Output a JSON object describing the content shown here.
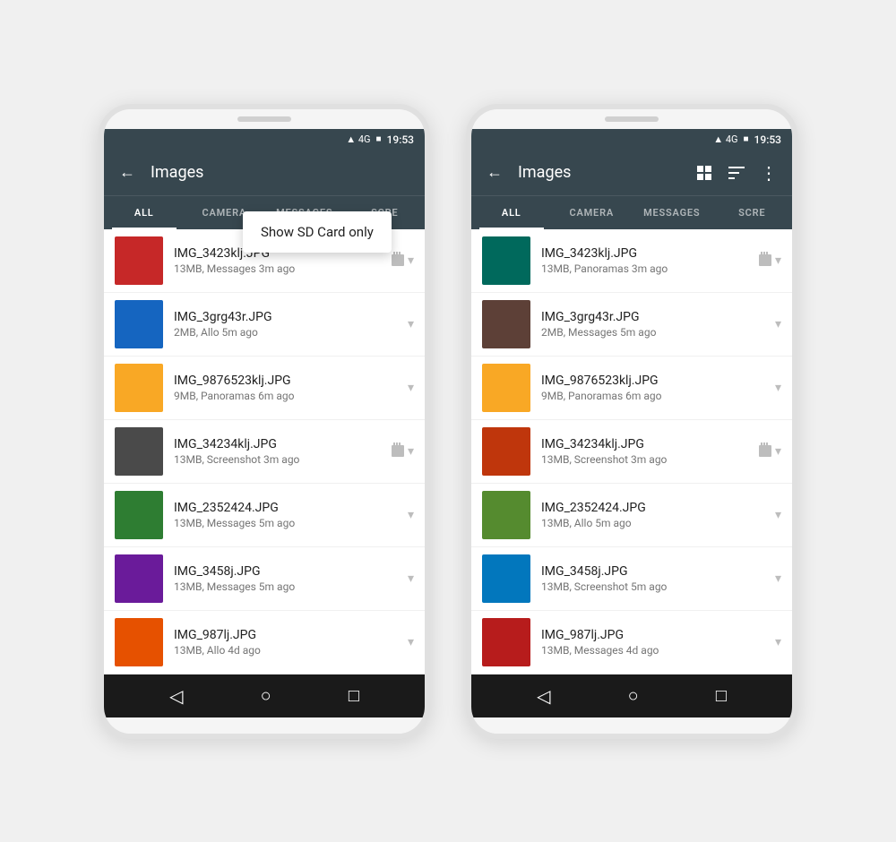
{
  "phones": [
    {
      "id": "phone-left",
      "statusBar": {
        "signal": "▲ 4G",
        "battery": "🔋",
        "time": "19:53"
      },
      "appBar": {
        "backIcon": "←",
        "title": "Images",
        "showDropdown": true
      },
      "dropdown": {
        "label": "Show SD Card only"
      },
      "tabs": [
        {
          "label": "ALL",
          "active": true
        },
        {
          "label": "CAMERA",
          "active": false
        },
        {
          "label": "MESSAGES",
          "active": false
        },
        {
          "label": "SCRE",
          "active": false
        }
      ],
      "files": [
        {
          "name": "IMG_3423klj.JPG",
          "meta": "13MB, Messages  3m ago",
          "thumbClass": "thumb-red"
        },
        {
          "name": "IMG_3grg43r.JPG",
          "meta": "2MB, Allo  5m ago",
          "thumbClass": "thumb-blue-crowd"
        },
        {
          "name": "IMG_9876523klj.JPG",
          "meta": "9MB, Panoramas  6m ago",
          "thumbClass": "thumb-yellow"
        },
        {
          "name": "IMG_34234klj.JPG",
          "meta": "13MB, Screenshot  3m ago",
          "thumbClass": "thumb-dark"
        },
        {
          "name": "IMG_2352424.JPG",
          "meta": "13MB, Messages  5m ago",
          "thumbClass": "thumb-green"
        },
        {
          "name": "IMG_3458j.JPG",
          "meta": "13MB, Messages  5m ago",
          "thumbClass": "thumb-purple"
        },
        {
          "name": "IMG_987lj.JPG",
          "meta": "13MB, Allo  4d ago",
          "thumbClass": "thumb-orange"
        }
      ],
      "navBar": {
        "backIcon": "◁",
        "homeIcon": "○",
        "recentIcon": "□"
      }
    },
    {
      "id": "phone-right",
      "statusBar": {
        "signal": "▲ 4G",
        "battery": "🔋",
        "time": "19:53"
      },
      "appBar": {
        "backIcon": "←",
        "title": "Images",
        "showDropdown": false,
        "gridIcon": "⊞",
        "sortIcon": "≡",
        "moreIcon": "⋮"
      },
      "tabs": [
        {
          "label": "ALL",
          "active": true
        },
        {
          "label": "CAMERA",
          "active": false
        },
        {
          "label": "MESSAGES",
          "active": false
        },
        {
          "label": "SCRE",
          "active": false
        }
      ],
      "files": [
        {
          "name": "IMG_3423klj.JPG",
          "meta": "13MB, Panoramas  3m ago",
          "thumbClass": "thumb-teal"
        },
        {
          "name": "IMG_3grg43r.JPG",
          "meta": "2MB, Messages  5m ago",
          "thumbClass": "thumb-brown"
        },
        {
          "name": "IMG_9876523klj.JPG",
          "meta": "9MB, Panoramas  6m ago",
          "thumbClass": "thumb-yellow"
        },
        {
          "name": "IMG_34234klj.JPG",
          "meta": "13MB, Screenshot  3m ago",
          "thumbClass": "thumb-sunset"
        },
        {
          "name": "IMG_2352424.JPG",
          "meta": "13MB, Allo  5m ago",
          "thumbClass": "thumb-food2"
        },
        {
          "name": "IMG_3458j.JPG",
          "meta": "13MB, Screenshot  5m ago",
          "thumbClass": "thumb-sea"
        },
        {
          "name": "IMG_987lj.JPG",
          "meta": "13MB, Messages  4d ago",
          "thumbClass": "thumb-red2"
        }
      ],
      "navBar": {
        "backIcon": "◁",
        "homeIcon": "○",
        "recentIcon": "□"
      }
    }
  ]
}
